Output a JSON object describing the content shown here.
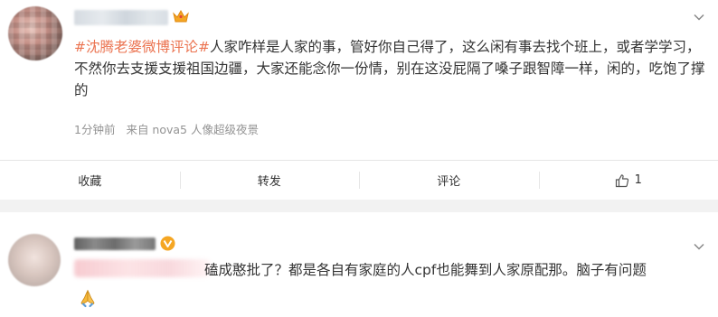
{
  "post": {
    "topic": "#沈腾老婆微博评论#",
    "body": "人家咋样是人家的事，管好你自己得了，这么闲有事去找个班上，或者学学习，不然你去支援支援祖国边疆，大家还能念你一份情，别在这没屁隔了嗓子跟智障一样，闲的，吃饱了撑的",
    "time": "1分钟前",
    "source": "来自 nova5 人像超级夜景"
  },
  "actions": {
    "favorite": "收藏",
    "repost": "转发",
    "comment": "评论",
    "like_count": "1"
  },
  "comment": {
    "text": "磕成憨批了？都是各自有家庭的人cpf也能舞到人家原配那。脑子有问题",
    "emoji": "🙏"
  },
  "colors": {
    "topic": "#eb7350",
    "meta": "#939393",
    "crown": "#f5a623",
    "vip": "#f5a623",
    "separator": "#f2f2f2"
  },
  "icons": [
    "crown-icon",
    "chevron-down-icon",
    "like-thumb-icon",
    "vip-badge-icon",
    "praying-hands-emoji"
  ]
}
